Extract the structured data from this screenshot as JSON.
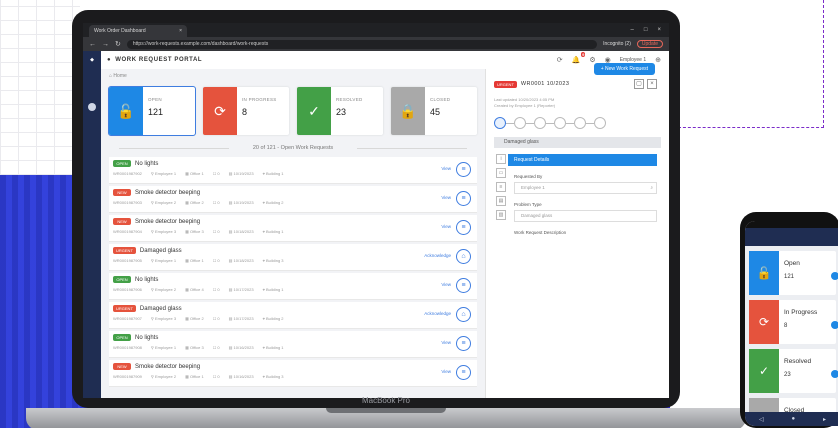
{
  "browser": {
    "tab_title": "Work Order Dashboard",
    "url": "https://work-requests.example.com/dashboard/work-requests",
    "incognito_label": "Incognito (2)",
    "update_label": "Update"
  },
  "header": {
    "portal_title": "WORK REQUEST PORTAL",
    "notification_count": "9",
    "user_name": "Employee 1"
  },
  "breadcrumb": "Home",
  "new_request_label": "+ New Work Request",
  "cards": [
    {
      "label": "OPEN",
      "count": "121",
      "color": "#1e88e5",
      "icon": "lock-open-icon",
      "glyph": "🔓"
    },
    {
      "label": "IN PROGRESS",
      "count": "8",
      "color": "#e5533d",
      "icon": "progress-icon",
      "glyph": "⟳"
    },
    {
      "label": "RESOLVED",
      "count": "23",
      "color": "#43a047",
      "icon": "check-circle-icon",
      "glyph": "✓"
    },
    {
      "label": "CLOSED",
      "count": "45",
      "color": "#a9a9a9",
      "icon": "lock-icon",
      "glyph": "🔒"
    }
  ],
  "list_heading": "20 of 121 - Open Work Requests",
  "requests": [
    {
      "status": "OPEN",
      "status_color": "#43a047",
      "title": "No lights",
      "id": "WR0001987902",
      "assignee": "Employee 1",
      "office": "Office 1",
      "comments": "0",
      "created": "10/19/2023",
      "location": "Building 1",
      "action": "View",
      "glyph": "≡"
    },
    {
      "status": "NEW",
      "status_color": "#e5533d",
      "title": "Smoke detector beeping",
      "id": "WR0001987903",
      "assignee": "Employee 2",
      "office": "Office 2",
      "comments": "0",
      "created": "10/19/2023",
      "location": "Building 2",
      "action": "View",
      "glyph": "≡"
    },
    {
      "status": "NEW",
      "status_color": "#e5533d",
      "title": "Smoke detector beeping",
      "id": "WR0001987904",
      "assignee": "Employee 3",
      "office": "Office 3",
      "comments": "0",
      "created": "10/18/2023",
      "location": "Building 1",
      "action": "View",
      "glyph": "≡"
    },
    {
      "status": "URGENT",
      "status_color": "#e5533d",
      "title": "Damaged glass",
      "id": "WR0001987905",
      "assignee": "Employee 1",
      "office": "Office 1",
      "comments": "0",
      "created": "10/18/2023",
      "location": "Building 3",
      "action": "Acknowledge",
      "glyph": "⌂"
    },
    {
      "status": "OPEN",
      "status_color": "#43a047",
      "title": "No lights",
      "id": "WR0001987906",
      "assignee": "Employee 2",
      "office": "Office 4",
      "comments": "0",
      "created": "10/17/2023",
      "location": "Building 1",
      "action": "View",
      "glyph": "≡"
    },
    {
      "status": "URGENT",
      "status_color": "#e5533d",
      "title": "Damaged glass",
      "id": "WR0001987907",
      "assignee": "Employee 3",
      "office": "Office 2",
      "comments": "0",
      "created": "10/17/2023",
      "location": "Building 2",
      "action": "Acknowledge",
      "glyph": "⌂"
    },
    {
      "status": "OPEN",
      "status_color": "#43a047",
      "title": "No lights",
      "id": "WR0001987908",
      "assignee": "Employee 1",
      "office": "Office 3",
      "comments": "0",
      "created": "10/16/2023",
      "location": "Building 1",
      "action": "View",
      "glyph": "≡"
    },
    {
      "status": "NEW",
      "status_color": "#e5533d",
      "title": "Smoke detector beeping",
      "id": "WR0001987909",
      "assignee": "Employee 2",
      "office": "Office 1",
      "comments": "0",
      "created": "10/16/2023",
      "location": "Building 3",
      "action": "View",
      "glyph": "≡"
    }
  ],
  "panel": {
    "badge": "URGENT",
    "title": "WR0001 10/2023",
    "subtitle_1": "Last updated 10/20/2023 4:05 PM",
    "subtitle_2": "Created by Employee 1 (Reporter)",
    "category_tab": "Damaged glass",
    "form_header": "Request Details",
    "requested_by_label": "Requested By",
    "requested_by_value": "Employee 1",
    "problem_type_label": "Problem Type",
    "problem_type_value": "Damaged glass",
    "description_label": "Work Request Description"
  },
  "laptop_label": "MacBook Pro",
  "phone": {
    "cards": [
      {
        "label": "Open",
        "count": "121",
        "color": "#1e88e5",
        "icon": "lock-open-icon",
        "glyph": "🔓"
      },
      {
        "label": "In Progress",
        "count": "8",
        "color": "#e5533d",
        "icon": "progress-icon",
        "glyph": "⟳"
      },
      {
        "label": "Resolved",
        "count": "23",
        "color": "#43a047",
        "icon": "check-circle-icon",
        "glyph": "✓"
      },
      {
        "label": "Closed",
        "count": "45",
        "color": "#a9a9a9",
        "icon": "lock-icon",
        "glyph": "🔒"
      }
    ]
  }
}
